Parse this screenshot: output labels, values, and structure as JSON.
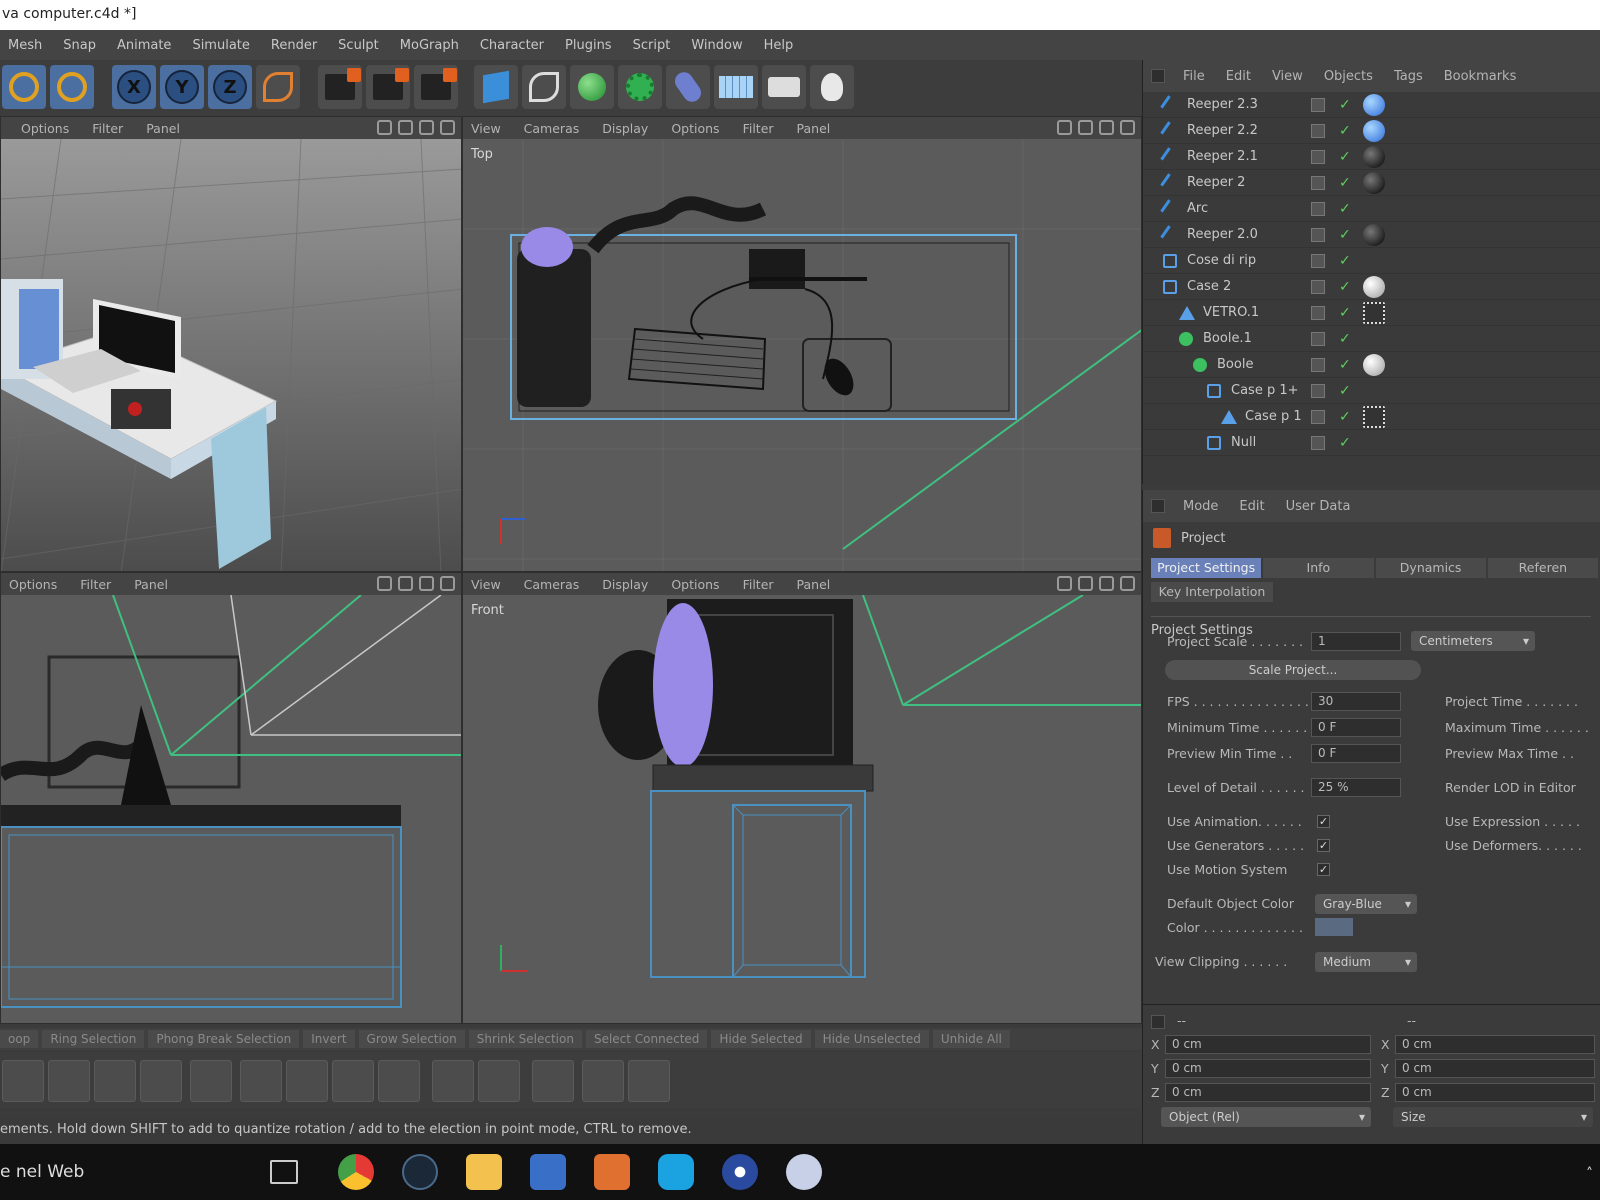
{
  "window": {
    "title": "va computer.c4d *]"
  },
  "menu": [
    "Mesh",
    "Snap",
    "Animate",
    "Simulate",
    "Render",
    "Sculpt",
    "MoGraph",
    "Character",
    "Plugins",
    "Script",
    "Window",
    "Help"
  ],
  "toolbar": {
    "icons": [
      "rotate-icon",
      "scale-icon",
      "x-axis-icon",
      "y-axis-icon",
      "z-axis-icon",
      "coordinate-system-icon",
      "render-view-icon",
      "render-picture-viewer-icon",
      "edit-render-settings-icon",
      "cube-icon",
      "spline-pen-icon",
      "sphere-icon",
      "gear-generator-icon",
      "capsule-icon",
      "floor-icon",
      "camera-icon",
      "light-icon"
    ],
    "axis_labels": [
      "X",
      "Y",
      "Z"
    ]
  },
  "viewports": {
    "perspective": {
      "menu": [
        "Options",
        "Filter",
        "Panel"
      ]
    },
    "top": {
      "menu": [
        "View",
        "Cameras",
        "Display",
        "Options",
        "Filter",
        "Panel"
      ],
      "label": "Top"
    },
    "right": {
      "menu": [
        "Options",
        "Filter",
        "Panel"
      ]
    },
    "front": {
      "menu": [
        "View",
        "Cameras",
        "Display",
        "Options",
        "Filter",
        "Panel"
      ],
      "label": "Front"
    }
  },
  "object_manager": {
    "menu": [
      "File",
      "Edit",
      "View",
      "Objects",
      "Tags",
      "Bookmarks"
    ],
    "objects": [
      {
        "name": "Reeper 2.3",
        "icon": "spline-icon",
        "tag": "blue"
      },
      {
        "name": "Reeper 2.2",
        "icon": "spline-icon",
        "tag": "blue"
      },
      {
        "name": "Reeper 2.1",
        "icon": "spline-icon",
        "tag": "black"
      },
      {
        "name": "Reeper 2",
        "icon": "spline-icon",
        "tag": "black"
      },
      {
        "name": "Arc",
        "icon": "spline-icon",
        "tag": ""
      },
      {
        "name": "Reeper 2.0",
        "icon": "spline-icon",
        "tag": "black"
      },
      {
        "name": "Cose di rip",
        "icon": "null-icon",
        "tag": ""
      },
      {
        "name": "Case 2",
        "icon": "null-icon",
        "tag": "white"
      },
      {
        "name": "VETRO.1",
        "icon": "polygon-icon",
        "tag": "dots"
      },
      {
        "name": "Boole.1",
        "icon": "boole-icon",
        "tag": ""
      },
      {
        "name": "Boole",
        "icon": "boole-icon",
        "tag": "white"
      },
      {
        "name": "Case p 1+",
        "icon": "null-icon",
        "tag": ""
      },
      {
        "name": "Case p 1",
        "icon": "polygon-icon",
        "tag": "dots"
      },
      {
        "name": "Null",
        "icon": "null-icon",
        "tag": ""
      }
    ]
  },
  "attribute_manager": {
    "menu": [
      "Mode",
      "Edit",
      "User Data"
    ],
    "title": "Project",
    "tabs": [
      "Project Settings",
      "Info",
      "Dynamics",
      "Referen"
    ],
    "tab_row2": "Key Interpolation",
    "section": "Project Settings",
    "fields": {
      "project_scale_label": "Project Scale . . . . . . .",
      "project_scale_value": "1",
      "project_scale_unit": "Centimeters",
      "scale_project_button": "Scale Project...",
      "fps_label": "FPS . . . . . . . . . . . . . . .",
      "fps_value": "30",
      "project_time_label": "Project Time . . . . . . .",
      "min_time_label": "Minimum Time . . . . . .",
      "min_time_value": "0 F",
      "max_time_label": "Maximum Time . . . . . .",
      "preview_min_label": "Preview Min Time . .",
      "preview_min_value": "0 F",
      "preview_max_label": "Preview Max Time . .",
      "lod_label": "Level of Detail . . . . . .",
      "lod_value": "25 %",
      "render_lod_label": "Render LOD in Editor",
      "use_animation_label": "Use Animation. . . . . .",
      "use_expression_label": "Use Expression . . . . .",
      "use_generators_label": "Use Generators . . . . .",
      "use_deformers_label": "Use Deformers. . . . . .",
      "use_motion_label": "Use Motion System",
      "default_color_label": "Default Object Color",
      "default_color_value": "Gray-Blue",
      "color_label": "Color . . . . . . . . . . . . .",
      "view_clipping_label": "View Clipping . . . . . .",
      "view_clipping_value": "Medium"
    }
  },
  "coordinates": {
    "header_left": "--",
    "header_right": "--",
    "rows": [
      {
        "a": "X",
        "av": "0 cm",
        "b": "X",
        "bv": "0 cm"
      },
      {
        "a": "Y",
        "av": "0 cm",
        "b": "Y",
        "bv": "0 cm"
      },
      {
        "a": "Z",
        "av": "0 cm",
        "b": "Z",
        "bv": "0 cm"
      }
    ],
    "mode": "Object (Rel)",
    "size": "Size"
  },
  "selection_bar": [
    "oop",
    "Ring Selection",
    "Phong Break Selection",
    "Invert",
    "Grow Selection",
    "Shrink Selection",
    "Select Connected",
    "Hide Selected",
    "Hide Unselected",
    "Unhide All"
  ],
  "status": "ements. Hold down SHIFT to add to quantize rotation / add to the election in point mode, CTRL to remove.",
  "taskbar": {
    "search": "e nel Web",
    "apps": [
      "task-view-icon",
      "chrome-icon",
      "steam-icon",
      "file-explorer-icon",
      "taskmanager-icon",
      "media-player-icon",
      "skype-icon",
      "cinema4d-icon",
      "paint-icon"
    ]
  },
  "colors": {
    "accent": "#6a80b8",
    "background": "#3b3b3b",
    "viewport": "#5b5b5b"
  }
}
